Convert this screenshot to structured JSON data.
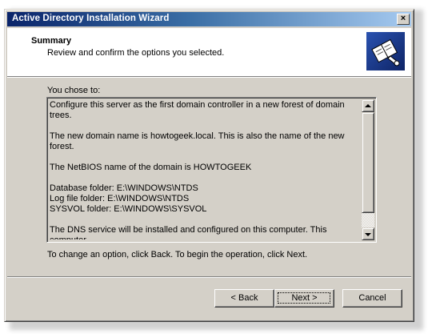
{
  "window": {
    "title": "Active Directory Installation Wizard",
    "close_label": "×"
  },
  "header": {
    "title": "Summary",
    "subtitle": "Review and confirm the options you selected.",
    "icon": "directory-book-icon"
  },
  "main": {
    "you_chose_label": "You chose to:",
    "summary_paragraphs": [
      "Configure this server as the first domain controller in a new forest of domain trees.",
      "The new domain name is howtogeek.local. This is also the name of the new forest.",
      "The NetBIOS name of the domain is HOWTOGEEK",
      "Database folder: E:\\WINDOWS\\NTDS\nLog file folder: E:\\WINDOWS\\NTDS\nSYSVOL folder: E:\\WINDOWS\\SYSVOL",
      "The DNS service will be installed and configured on this computer. This computer\nwill be configured to use this DNS server as its preferred DNS server."
    ],
    "instruction": "To change an option, click Back. To begin the operation, click Next."
  },
  "buttons": {
    "back_prefix": "< ",
    "back_label": "Back",
    "next_label": "Next",
    "next_suffix": " >",
    "cancel_label": "Cancel"
  },
  "colors": {
    "titlebar_start": "#0a246a",
    "titlebar_end": "#a6caf0",
    "face": "#d4d0c8"
  }
}
